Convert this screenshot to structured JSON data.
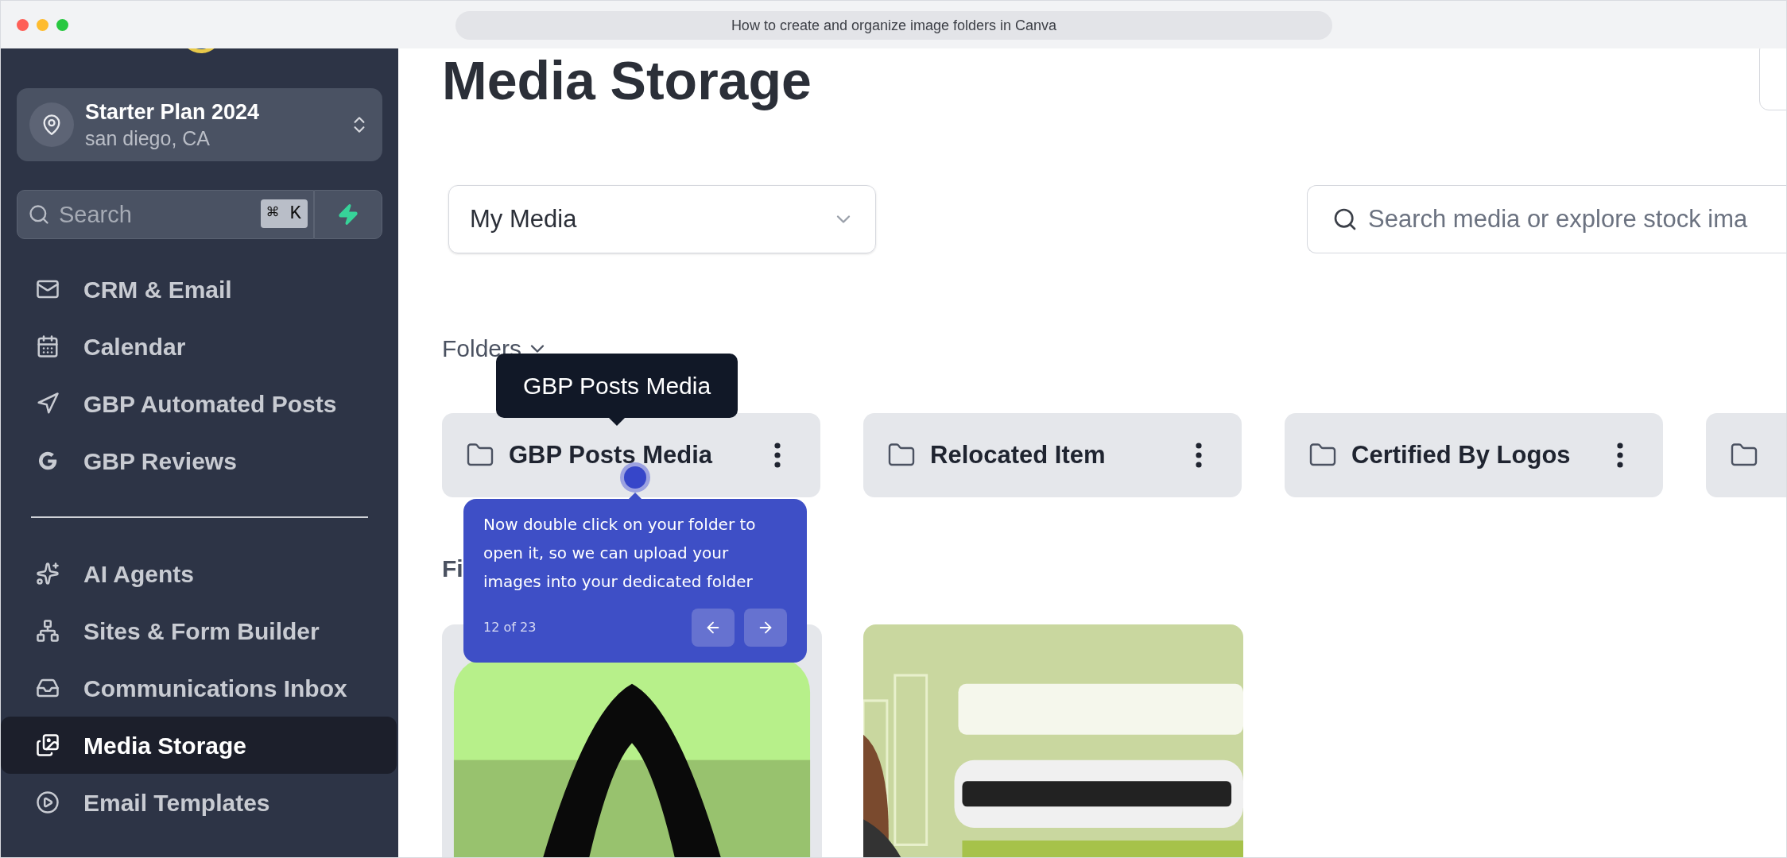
{
  "browser": {
    "address": "How to create and organize image folders in Canva"
  },
  "sidebar": {
    "account": {
      "name": "Starter Plan 2024",
      "location": "san diego, CA"
    },
    "search": {
      "placeholder": "Search",
      "shortcut": "⌘ K"
    },
    "items": [
      {
        "label": "CRM & Email",
        "selected": false
      },
      {
        "label": "Calendar",
        "selected": false
      },
      {
        "label": "GBP Automated Posts",
        "selected": false
      },
      {
        "label": "GBP Reviews",
        "selected": false
      },
      {
        "label": "AI Agents",
        "selected": false
      },
      {
        "label": "Sites & Form Builder",
        "selected": false
      },
      {
        "label": "Communications Inbox",
        "selected": false
      },
      {
        "label": "Media Storage",
        "selected": true
      },
      {
        "label": "Email Templates",
        "selected": false
      }
    ]
  },
  "page": {
    "title": "Media Storage",
    "source_select": "My Media",
    "search": {
      "placeholder": "Search media or explore stock ima"
    },
    "folders_label": "Folders",
    "folders": [
      {
        "kind": "folder",
        "name": "GBP Posts Media"
      },
      {
        "kind": "folder",
        "name": "Relocated Item"
      },
      {
        "kind": "folder",
        "name": "Certified By Logos"
      },
      {
        "kind": "cut_off"
      }
    ],
    "files_label": "Fi"
  },
  "hover_tooltip": "GBP Posts Media",
  "guide": {
    "text": "Now double click on your folder to open it, so we can upload your images into your dedicated folder",
    "step": "12 of 23"
  }
}
